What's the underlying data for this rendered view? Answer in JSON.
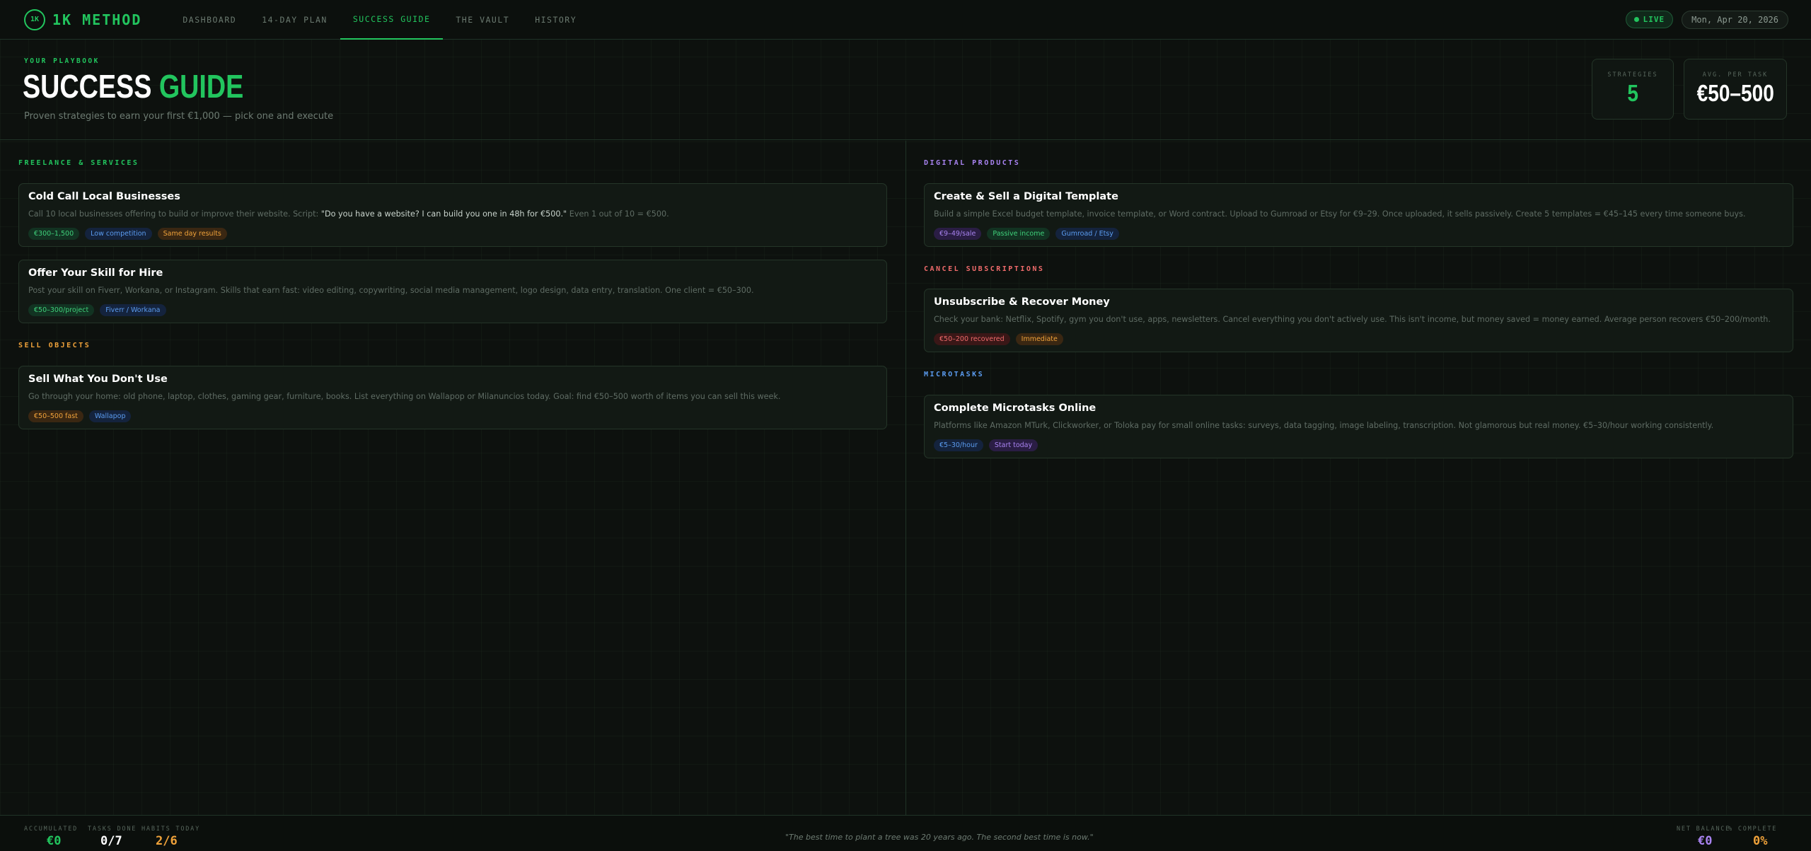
{
  "brand": {
    "logo_text": "1K",
    "name": "1K METHOD"
  },
  "nav": {
    "items": [
      "DASHBOARD",
      "14-DAY PLAN",
      "SUCCESS GUIDE",
      "THE VAULT",
      "HISTORY"
    ],
    "active": "SUCCESS GUIDE"
  },
  "status": {
    "live": "LIVE",
    "date": "Mon, Apr 20, 2026"
  },
  "header": {
    "eyebrow": "YOUR PLAYBOOK",
    "title_main": "SUCCESS ",
    "title_accent": "GUIDE",
    "subtitle": "Proven strategies to earn your first €1,000 — pick one and execute"
  },
  "stats": {
    "strategies_label": "STRATEGIES",
    "strategies_value": "5",
    "avg_label": "AVG. PER TASK",
    "avg_value": "€50–500"
  },
  "left": {
    "freelance_label": "FREELANCE & SERVICES",
    "cold_call": {
      "title": "Cold Call Local Businesses",
      "desc_pre": "Call 10 local businesses offering to build or improve their website. Script: ",
      "desc_quote": "\"Do you have a website? I can build you one in 48h for €500.\"",
      "desc_post": " Even 1 out of 10 = €500.",
      "tags": [
        "€300–1,500",
        "Low competition",
        "Same day results"
      ]
    },
    "skill": {
      "title": "Offer Your Skill for Hire",
      "desc": "Post your skill on Fiverr, Workana, or Instagram. Skills that earn fast: video editing, copywriting, social media management, logo design, data entry, translation. One client = €50–300.",
      "tags": [
        "€50–300/project",
        "Fiverr / Workana"
      ]
    },
    "sell_label": "SELL OBJECTS",
    "sell": {
      "title": "Sell What You Don't Use",
      "desc": "Go through your home: old phone, laptop, clothes, gaming gear, furniture, books. List everything on Wallapop or Milanuncios today. Goal: find €50–500 worth of items you can sell this week.",
      "tags": [
        "€50–500 fast",
        "Wallapop"
      ]
    }
  },
  "right": {
    "digital_label": "DIGITAL PRODUCTS",
    "template": {
      "title": "Create & Sell a Digital Template",
      "desc": "Build a simple Excel budget template, invoice template, or Word contract. Upload to Gumroad or Etsy for €9–29. Once uploaded, it sells passively. Create 5 templates = €45–145 every time someone buys.",
      "tags": [
        "€9–49/sale",
        "Passive income",
        "Gumroad / Etsy"
      ]
    },
    "cancel_label": "CANCEL SUBSCRIPTIONS",
    "unsubscribe": {
      "title": "Unsubscribe & Recover Money",
      "desc": "Check your bank: Netflix, Spotify, gym you don't use, apps, newsletters. Cancel everything you don't actively use. This isn't income, but money saved = money earned. Average person recovers €50–200/month.",
      "tags": [
        "€50–200 recovered",
        "Immediate"
      ]
    },
    "micro_label": "MICROTASKS",
    "micro": {
      "title": "Complete Microtasks Online",
      "desc": "Platforms like Amazon MTurk, Clickworker, or Toloka pay for small online tasks: surveys, data tagging, image labeling, transcription. Not glamorous but real money. €5–30/hour working consistently.",
      "tags": [
        "€5–30/hour",
        "Start today"
      ]
    }
  },
  "footer": {
    "accumulated_label": "ACCUMULATED",
    "accumulated_value": "€0",
    "tasks_label": "TASKS DONE",
    "tasks_value": "0/7",
    "habits_label": "HABITS TODAY",
    "habits_value": "2/6",
    "quote": "\"The best time to plant a tree was 20 years ago. The second best time is now.\"",
    "balance_label": "NET BALANCE",
    "balance_value": "€0",
    "complete_label": "% COMPLETE",
    "complete_value": "0%"
  },
  "colors": {
    "accent_green": "#22c55e",
    "purple": "#a883f0",
    "red": "#ef6b6b",
    "orange": "#f0a23a",
    "blue": "#5b9cf0"
  }
}
